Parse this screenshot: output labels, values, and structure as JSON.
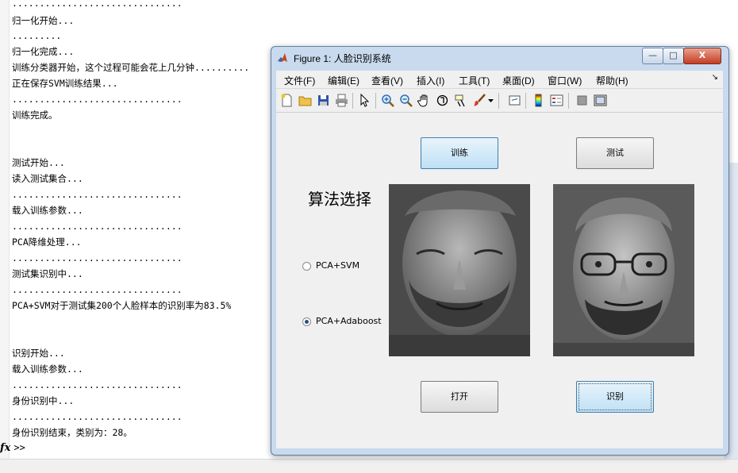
{
  "console": {
    "lines": [
      "...............................",
      "归一化开始...",
      ".........",
      "归一化完成...",
      "训练分类器开始，这个过程可能会花上几分钟..........",
      "正在保存SVM训练结果...",
      "...............................",
      "训练完成。",
      "",
      "",
      "测试开始...",
      "读入测试集合...",
      "...............................",
      "载入训练参数...",
      "...............................",
      "PCA降维处理...",
      "...............................",
      "测试集识别中...",
      "...............................",
      "PCA+SVM对于测试集200个人脸样本的识别率为83.5%",
      "",
      "",
      "识别开始...",
      "载入训练参数...",
      "...............................",
      "身份识别中...",
      "...............................",
      "身份识别结束，类别为：28。"
    ],
    "prompt_fx": "fx",
    "prompt": ">>"
  },
  "window": {
    "title": "Figure 1: 人脸识别系统",
    "min": "—",
    "max": "□",
    "close": "X"
  },
  "menubar": {
    "items": [
      "文件(F)",
      "编辑(E)",
      "查看(V)",
      "插入(I)",
      "工具(T)",
      "桌面(D)",
      "窗口(W)",
      "帮助(H)"
    ],
    "expand": "↘"
  },
  "toolbar": {
    "icons": [
      "new-file",
      "open-folder",
      "save",
      "print",
      "pointer",
      "zoom-in",
      "zoom-out",
      "pan-hand",
      "rotate-3d",
      "data-cursor",
      "brush",
      "brush-dropdown",
      "link-plot",
      "colorbar",
      "legend",
      "hide-plot-tools",
      "show-plot-tools"
    ]
  },
  "gui": {
    "train_btn": "训练",
    "test_btn": "测试",
    "algorithm_title": "算法选择",
    "radio_svm": "PCA+SVM",
    "radio_adaboost": "PCA+Adaboost",
    "radio_selected": "PCA+Adaboost",
    "open_btn": "打开",
    "recognize_btn": "识别"
  },
  "colors": {
    "window_frame": "#c9daee",
    "button_blue": "#bfe0f5",
    "close_red": "#c43d22"
  }
}
